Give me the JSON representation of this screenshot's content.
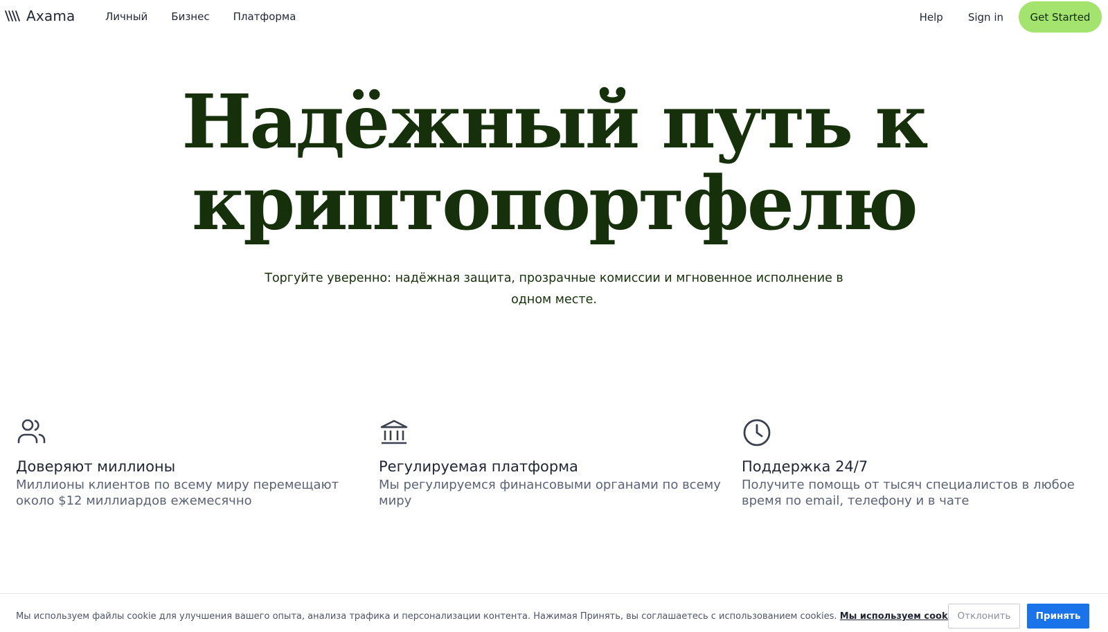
{
  "header": {
    "logo_text": "Axama",
    "nav": [
      {
        "label": "Личный"
      },
      {
        "label": "Бизнес"
      },
      {
        "label": "Платформа"
      }
    ],
    "help_label": "Help",
    "signin_label": "Sign in",
    "cta_label": "Get Started"
  },
  "hero": {
    "title_line1": "Надёжный путь к",
    "title_line2": "криптопортфелю",
    "subtitle": "Торгуйте уверенно: надёжная защита, прозрачные комиссии и мгновенное исполнение в одном месте."
  },
  "features": [
    {
      "icon": "users-icon",
      "title": "Доверяют миллионы",
      "description": "Миллионы клиентов по всему миру перемещают около $12 миллиардов ежемесячно"
    },
    {
      "icon": "bank-icon",
      "title": "Регулируемая платформа",
      "description": "Мы регулируемся финансовыми органами по всему миру"
    },
    {
      "icon": "clock-icon",
      "title": "Поддержка 24/7",
      "description": "Получите помощь от тысяч специалистов в любое время по email, телефону и в чате"
    }
  ],
  "cookie": {
    "text": "Мы используем файлы cookie для улучшения вашего опыта, анализа трафика и персонализации контента. Нажимая Принять, вы соглашаетесь с использованием cookies.",
    "link_label": "Мы используем cookies",
    "decline_label": "Отклонить",
    "accept_label": "Принять"
  },
  "colors": {
    "accent_green": "#a3e36e",
    "headline": "#15300a",
    "accept_blue": "#1a73e8"
  }
}
